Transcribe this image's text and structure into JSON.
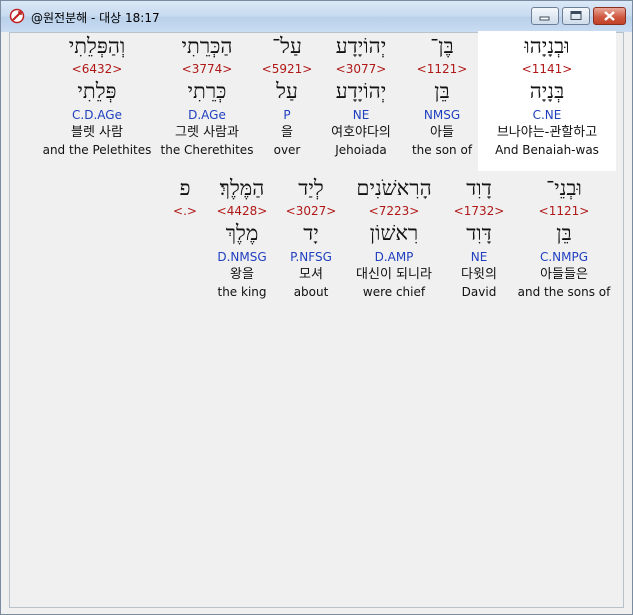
{
  "window": {
    "title": "@원전분해 - 대상 18:17",
    "icon": "bible-app-icon"
  },
  "controls": {
    "minimize": "minimize-icon",
    "maximize": "maximize-icon",
    "close": "close-icon"
  },
  "line1": [
    {
      "heb": "וּבְנָיָהוּ",
      "strong": "<1141>",
      "lemma": "בְּנָיָה",
      "morph": "C.NE",
      "kor": "브나야는-관할하고",
      "eng": "And Benaiah-was"
    },
    {
      "heb": "בֶּן־",
      "strong": "<1121>",
      "lemma": "בֵּן",
      "morph": "NMSG",
      "kor": "아들",
      "eng": "the son of"
    },
    {
      "heb": "יְהוֹיָדָע",
      "strong": "<3077>",
      "lemma": "יְהוֹיָדָע",
      "morph": "NE",
      "kor": "여호야다의",
      "eng": "Jehoiada"
    },
    {
      "heb": "עַל־",
      "strong": "<5921>",
      "lemma": "עַל",
      "morph": "P",
      "kor": "을",
      "eng": "over"
    },
    {
      "heb": "הַכְּרֵתִי",
      "strong": "<3774>",
      "lemma": "כְּרֵתִי",
      "morph": "D.AGe",
      "kor": "그렛 사람과",
      "eng": "the Cherethites"
    },
    {
      "heb": "וְהַפְּלֵתִי",
      "strong": "<6432>",
      "lemma": "פְּלֵתִי",
      "morph": "C.D.AGe",
      "kor": "블렛 사람",
      "eng": "and the Pelethites"
    }
  ],
  "line2": [
    {
      "heb": "וּבְנֵי־",
      "strong": "<1121>",
      "lemma": "בֵּן",
      "morph": "C.NMPG",
      "kor": "아들들은",
      "eng": "and the sons of"
    },
    {
      "heb": "דָוִד",
      "strong": "<1732>",
      "lemma": "דָּוִד",
      "morph": "NE",
      "kor": "다윗의",
      "eng": "David"
    },
    {
      "heb": "הָרִאשֹׁנִים",
      "strong": "<7223>",
      "lemma": "רִאשׁוֹן",
      "morph": "D.AMP",
      "kor": "대신이 되니라",
      "eng": "were chief"
    },
    {
      "heb": "לְיַד",
      "strong": "<3027>",
      "lemma": "יָד",
      "morph": "P.NFSG",
      "kor": "모셔",
      "eng": "about"
    },
    {
      "heb": "הַמֶּלֶךְ׃",
      "strong": "<4428>",
      "lemma": "מֶלֶךְ",
      "morph": "D.NMSG",
      "kor": "왕을",
      "eng": "the king"
    },
    {
      "heb": "פ",
      "strong": "<.>",
      "lemma": "",
      "morph": "",
      "kor": "",
      "eng": ""
    }
  ]
}
